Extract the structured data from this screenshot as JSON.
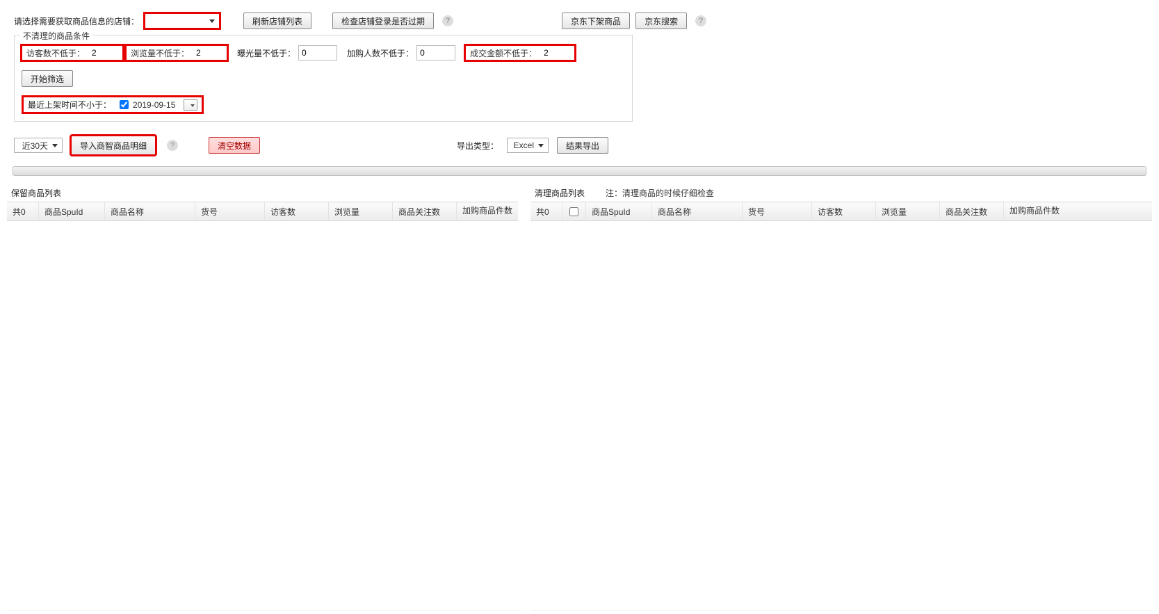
{
  "top": {
    "select_shop_label": "请选择需要获取商品信息的店铺：",
    "shop_value": "",
    "refresh_btn": "刷新店铺列表",
    "check_login_btn": "检查店铺登录是否过期",
    "jd_off_btn": "京东下架商品",
    "jd_search_btn": "京东搜索"
  },
  "filters": {
    "legend": "不清理的商品条件",
    "visitor_label": "访客数不低于：",
    "visitor_value": "2",
    "pv_label": "浏览量不低于：",
    "pv_value": "2",
    "expose_label": "曝光量不低于：",
    "expose_value": "0",
    "addcart_label": "加购人数不低于：",
    "addcart_value": "0",
    "deal_label": "成交金额不低于：",
    "deal_value": "2",
    "start_filter_btn": "开始筛选",
    "date_label": "最近上架时间不小于：",
    "date_value": "2019-09-15"
  },
  "mid": {
    "range_value": "近30天",
    "import_btn": "导入商智商品明细",
    "clear_btn": "清空数据",
    "export_type_label": "导出类型：",
    "export_type_value": "Excel",
    "export_btn": "结果导出"
  },
  "left_panel": {
    "title": "保留商品列表",
    "count_label": "共0",
    "cols": {
      "spu": "商品SpuId",
      "name": "商品名称",
      "code": "货号",
      "visitor": "访客数",
      "pv": "浏览量",
      "follow": "商品关注数",
      "addcart": "加购商品件数"
    }
  },
  "right_panel": {
    "title": "清理商品列表",
    "note": "注：清理商品的时候仔细检查",
    "count_label": "共0",
    "cols": {
      "spu": "商品SpuId",
      "name": "商品名称",
      "code": "货号",
      "visitor": "访客数",
      "pv": "浏览量",
      "follow": "商品关注数",
      "addcart": "加购商品件数"
    }
  }
}
